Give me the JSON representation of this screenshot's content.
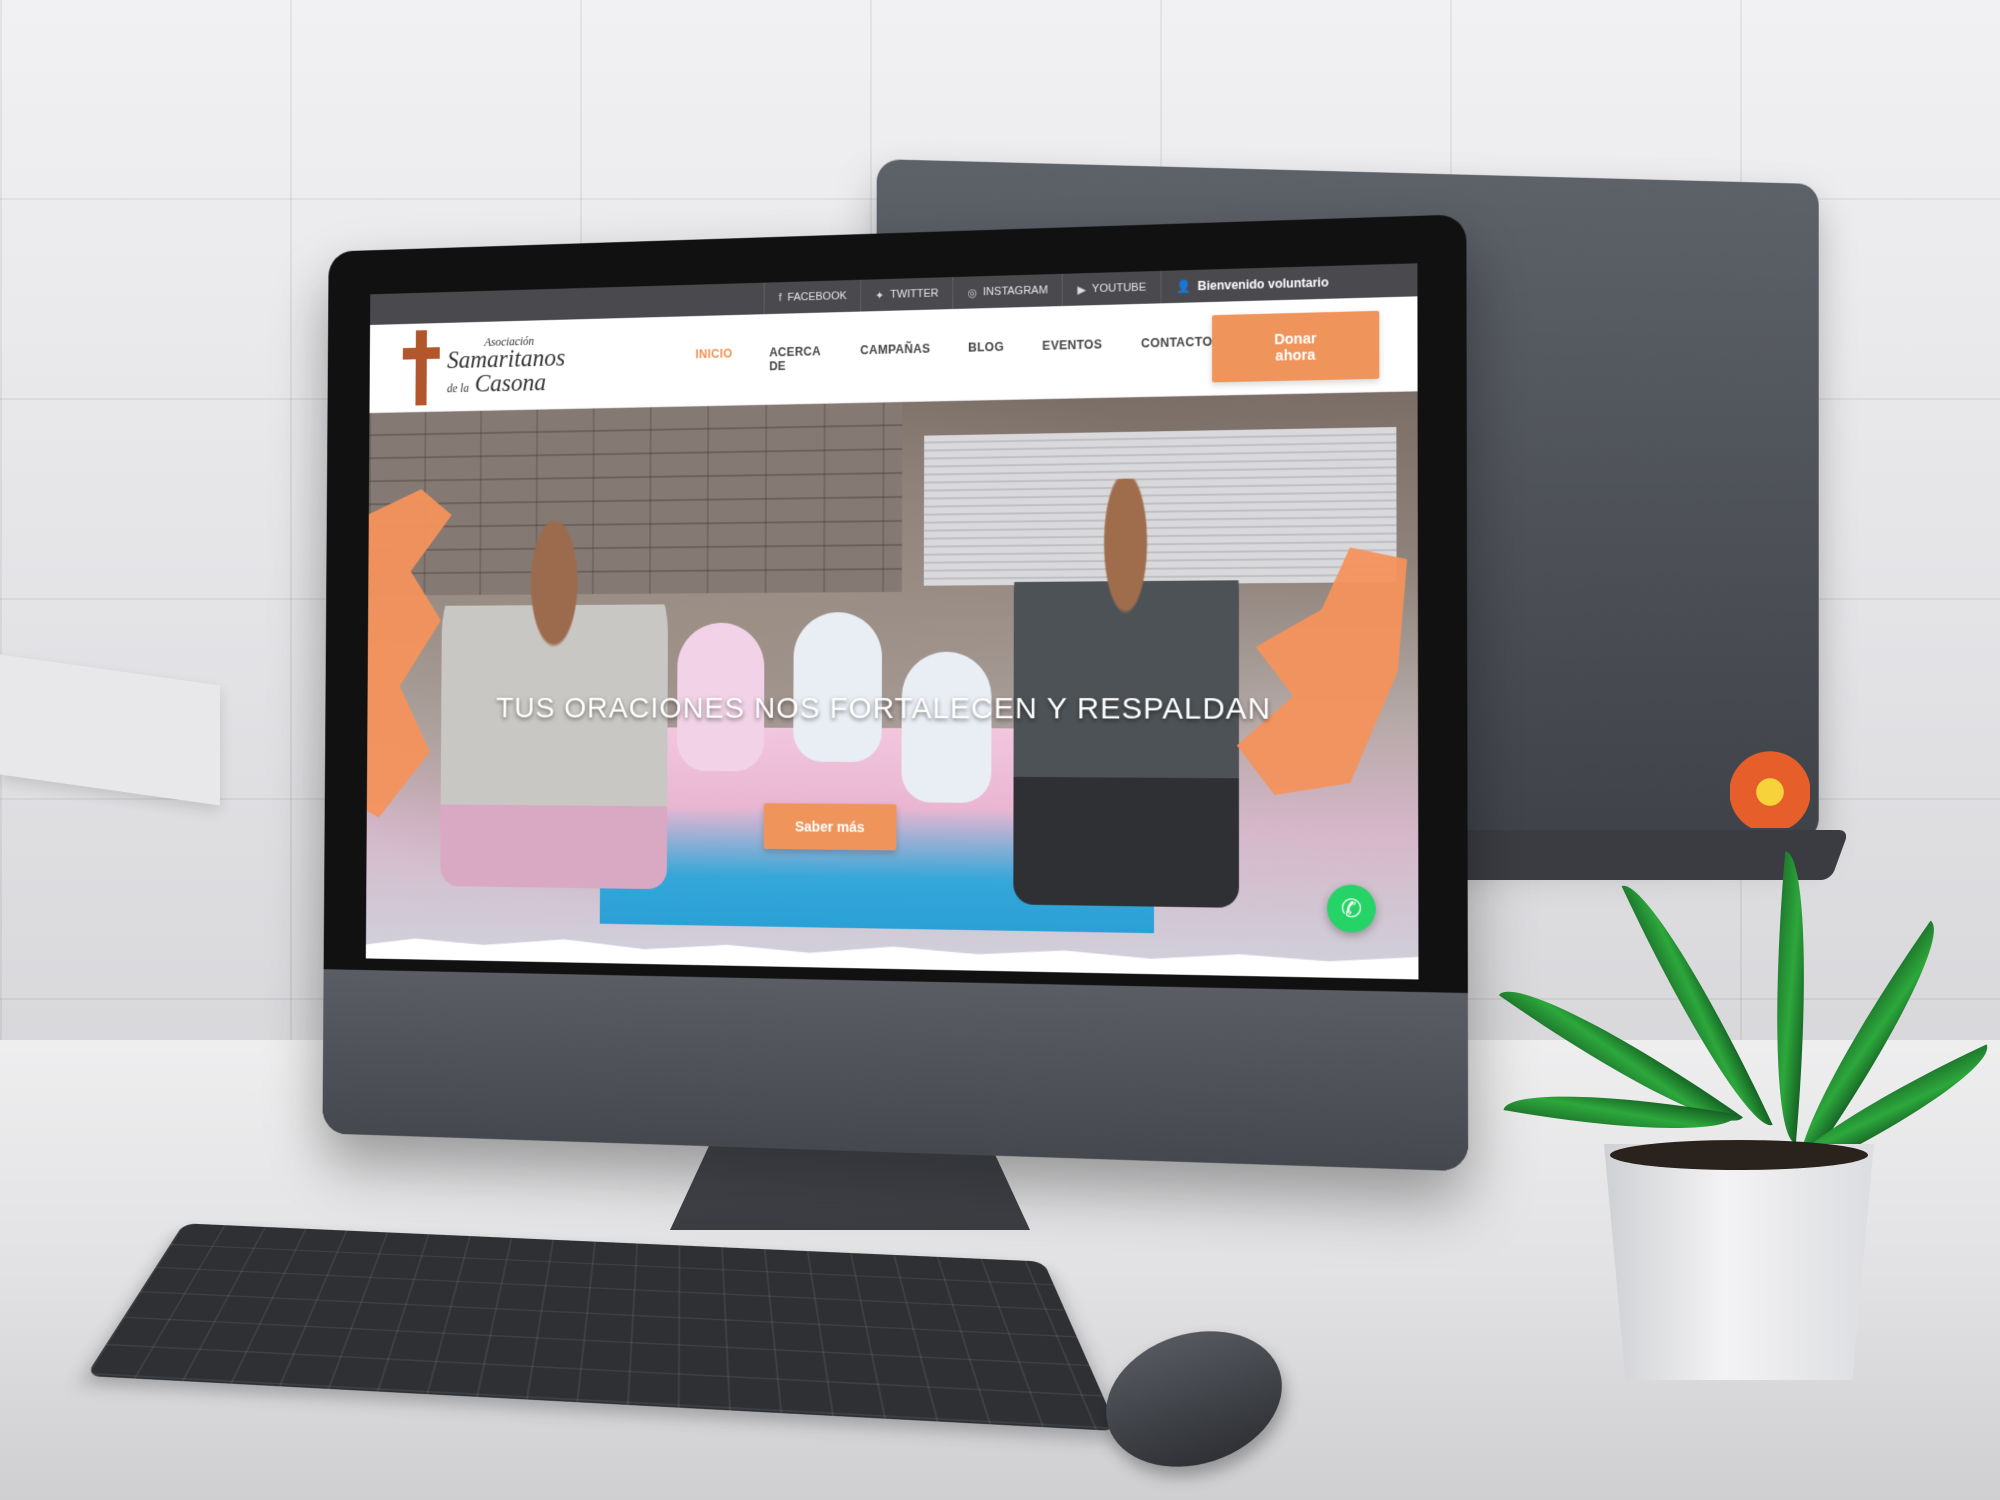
{
  "topbar": {
    "social": [
      {
        "label": "FACEBOOK",
        "icon": "facebook-icon"
      },
      {
        "label": "TWITTER",
        "icon": "twitter-icon"
      },
      {
        "label": "INSTAGRAM",
        "icon": "instagram-icon"
      },
      {
        "label": "YOUTUBE",
        "icon": "youtube-icon"
      }
    ],
    "volunteer_label": "Bienvenido voluntario"
  },
  "logo": {
    "line1": "Asociación",
    "line2": "Samaritanos",
    "line3_prefix": "de la",
    "line3": "Casona"
  },
  "nav": {
    "items": [
      {
        "label": "INICIO",
        "active": true
      },
      {
        "label": "ACERCA DE",
        "active": false
      },
      {
        "label": "CAMPAÑAS",
        "active": false
      },
      {
        "label": "BLOG",
        "active": false
      },
      {
        "label": "EVENTOS",
        "active": false
      },
      {
        "label": "CONTACTO",
        "active": false
      }
    ],
    "donate_label": "Donar ahora"
  },
  "hero": {
    "title": "TUS ORACIONES NOS FORTALECEN Y RESPALDAN",
    "button_label": "Saber más"
  },
  "colors": {
    "accent": "#ef955b",
    "topbar": "#4a4a4e",
    "whatsapp": "#25d366"
  }
}
